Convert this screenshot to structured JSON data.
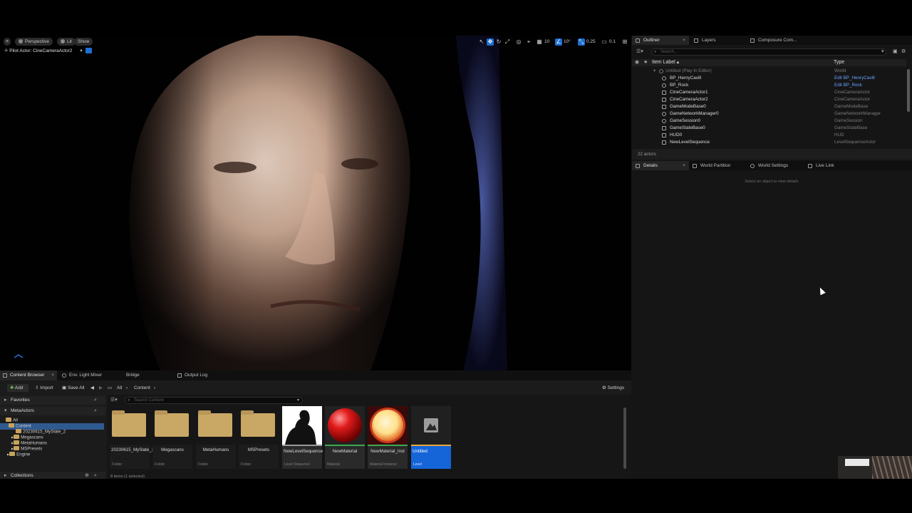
{
  "viewport": {
    "perspective_label": "Perspective",
    "lit_label": "Lit",
    "show_label": "Show",
    "pilot_label": "Pilot Actor: CineCameraActor2",
    "grid_value": "10",
    "rotation_value": "10°",
    "scale_value": "0.25",
    "camera_speed": "0.1"
  },
  "outliner": {
    "tabs": [
      {
        "label": "Outliner"
      },
      {
        "label": "Layers"
      },
      {
        "label": "Composure Com..."
      }
    ],
    "search_placeholder": "Search...",
    "col_item": "Item Label ▴",
    "col_type": "Type",
    "rows": [
      {
        "label": "Untitled (Play In Editor)",
        "type": "World"
      },
      {
        "label": "BP_HenryCavill",
        "type": "Edit BP_HenryCavill"
      },
      {
        "label": "BP_Rock",
        "type": "Edit BP_Rock"
      },
      {
        "label": "CineCameraActor1",
        "type": "CineCameraActor"
      },
      {
        "label": "CineCameraActor2",
        "type": "CineCameraActor"
      },
      {
        "label": "GameModeBase0",
        "type": "GameModeBase"
      },
      {
        "label": "GameNetworkManager0",
        "type": "GameNetworkManager"
      },
      {
        "label": "GameSession0",
        "type": "GameSession"
      },
      {
        "label": "GameStateBase0",
        "type": "GameStateBase"
      },
      {
        "label": "HUD0",
        "type": "HUD"
      },
      {
        "label": "NewLevelSequence",
        "type": "LevelSequenceActor"
      }
    ],
    "actor_count": "22 actors"
  },
  "details": {
    "tabs": [
      {
        "label": "Details"
      },
      {
        "label": "World Partition"
      },
      {
        "label": "World Settings"
      },
      {
        "label": "Live Link"
      }
    ],
    "empty_hint": "Select an object to view details."
  },
  "content_browser": {
    "tabs": [
      {
        "label": "Content Browser"
      },
      {
        "label": "Env. Light Mixer"
      },
      {
        "label": "Bridge"
      },
      {
        "label": "Output Log"
      }
    ],
    "add_label": "Add",
    "import_label": "Import",
    "save_all_label": "Save All",
    "breadcrumb": [
      "All",
      "Content"
    ],
    "settings_label": "Settings",
    "favorites_label": "Favorites",
    "metaactors_label": "MetaActors",
    "collections_label": "Collections",
    "search_placeholder": "Search Content",
    "tree": [
      {
        "label": "All"
      },
      {
        "label": "Content"
      },
      {
        "label": "20230615_MySlate_2"
      },
      {
        "label": "Megascans"
      },
      {
        "label": "MetaHumans"
      },
      {
        "label": "MSPresets"
      },
      {
        "label": "Engine"
      }
    ],
    "assets": [
      {
        "name": "20230615_MySlate_2",
        "kind": "Folder"
      },
      {
        "name": "Megascans",
        "kind": "Folder"
      },
      {
        "name": "MetaHumans",
        "kind": "Folder"
      },
      {
        "name": "MSPresets",
        "kind": "Folder"
      },
      {
        "name": "NewLevelSequence",
        "kind": "Level Sequence"
      },
      {
        "name": "NewMaterial",
        "kind": "Material"
      },
      {
        "name": "NewMaterial_Inst",
        "kind": "Material Instance"
      },
      {
        "name": "Untitled",
        "kind": "Level"
      }
    ],
    "status": "8 items (1 selected)"
  }
}
